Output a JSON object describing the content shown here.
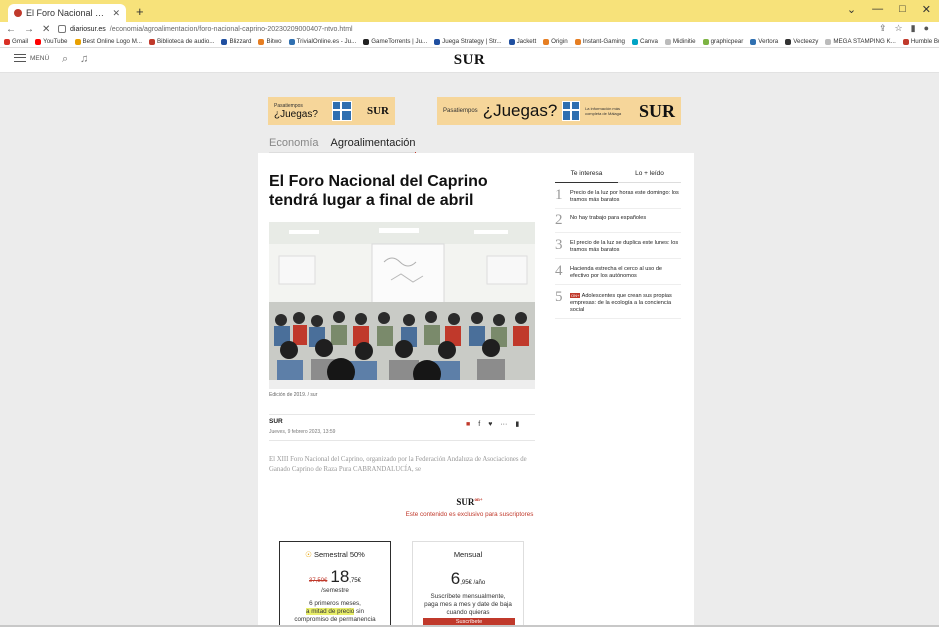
{
  "browser": {
    "tab_title": "El Foro Nacional del Caprino ten...",
    "new_tab": "+",
    "url_domain": "diariosur.es",
    "url_path": "/economia/agroalimentacion/foro-nacional-caprino-20230209000407-ntvo.html",
    "window_controls": [
      "⌄",
      "—",
      "□",
      "✕"
    ],
    "bookmarks": [
      {
        "label": "Gmail",
        "color": "#d93025"
      },
      {
        "label": "YouTube",
        "color": "#ff0000"
      },
      {
        "label": "Best Online Logo M...",
        "color": "#e8a000"
      },
      {
        "label": "Biblioteca de audio...",
        "color": "#c0392b"
      },
      {
        "label": "Blizzard",
        "color": "#1f4fa0"
      },
      {
        "label": "Bitwo",
        "color": "#e67e22"
      },
      {
        "label": "TrivialOnline.es - Ju...",
        "color": "#2f6fb0"
      },
      {
        "label": "GameTorrents | Ju...",
        "color": "#222222"
      },
      {
        "label": "Juega Strategy | Str...",
        "color": "#1f4fa0"
      },
      {
        "label": "Jackett",
        "color": "#1f4fa0"
      },
      {
        "label": "Origin",
        "color": "#e67e22"
      },
      {
        "label": "Instant-Gaming",
        "color": "#e67e22"
      },
      {
        "label": "Canva",
        "color": "#00a3c4"
      },
      {
        "label": "Midinitie",
        "color": "#bbbbbb"
      },
      {
        "label": "graphicpear",
        "color": "#7cb342"
      },
      {
        "label": "Vertora",
        "color": "#2f6fb0"
      },
      {
        "label": "Vecteezy",
        "color": "#333333"
      },
      {
        "label": "MEGA STAMPING K...",
        "color": "#bbbbbb"
      },
      {
        "label": "Humble Bundle",
        "color": "#c0392b"
      },
      {
        "label": "Free Icons | Font A...",
        "color": "#2f6fb0"
      }
    ]
  },
  "site": {
    "menu_label": "MENÚ",
    "logo": "SUR"
  },
  "ads": {
    "small": {
      "pre": "Pasatiempos",
      "juegas": "¿Juegas?",
      "logo": "SUR"
    },
    "big": {
      "pre": "Pasatiempos",
      "juegas": "¿Juegas?",
      "tagline": "La información más completa de Málaga",
      "logo": "SUR"
    }
  },
  "sections": [
    "Economía",
    "Agroalimentación"
  ],
  "article": {
    "headline": "El Foro Nacional del Caprino tendrá lugar a final de abril",
    "caption": "Edición de 2019. / sur",
    "author": "SUR",
    "date": "Jueves, 9 febrero 2023, 13:59",
    "lede": "El XIII Foro Nacional del Caprino, organizado por la Federación Andaluza de Asociaciones de Ganado Caprino de Raza Pura CABRANDALUCÍA, se",
    "subscriber_logo": "SUR",
    "subscriber_sup": "on+",
    "exclusive_note": "Este contenido es exclusivo para suscriptores"
  },
  "plans": [
    {
      "name": "Semestral 50%",
      "old_price": "37,50€",
      "price_main": "18",
      "price_cents": ",75€",
      "period": "/semestre",
      "desc_a": "6 primeros meses,",
      "desc_hl": "a mitad de precio",
      "desc_b": "sin",
      "desc_c": "compromiso de permanencia"
    },
    {
      "name": "Mensual",
      "price_main": "6",
      "price_cents": ",95€",
      "period": " /año",
      "desc_a": "Suscríbete mensualmente,",
      "desc_b": "paga mes a mes y date de baja",
      "desc_c": "cuando quieras",
      "button": "Suscríbete"
    }
  ],
  "sidebar": {
    "tabs": [
      "Te interesa",
      "Lo + leído"
    ],
    "items": [
      {
        "n": "1",
        "text": "Precio de la luz por horas este domingo: los tramos más baratos"
      },
      {
        "n": "2",
        "text": "No hay trabajo para españoles"
      },
      {
        "n": "3",
        "text": "El precio de la luz se duplica este lunes: los tramos más baratos"
      },
      {
        "n": "4",
        "text": "Hacienda estrecha el cerco al uso de efectivo por los autónomos"
      },
      {
        "n": "5",
        "tag": "ON+",
        "text": "Adolescentes que crean sus propias empresas: de la ecología a la conciencia social"
      }
    ]
  }
}
